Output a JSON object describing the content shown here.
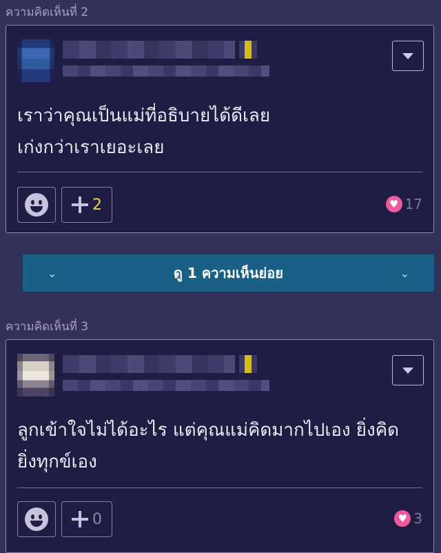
{
  "comments": [
    {
      "label": "ความคิดเห็นที่ 2",
      "avatar": "blue",
      "lines": [
        "เราว่าคุณเป็นแม่ที่อธิบายได้ดีเลย",
        "เก่งกว่าเราเยอะเลย"
      ],
      "plus_count": "2",
      "plus_count_color": "#f5d33c",
      "like_count": "17"
    },
    {
      "label": "ความคิดเห็นที่ 3",
      "avatar": "skin",
      "lines": [
        "ลูกเข้าใจไม่ได้อะไร แต่คุณแม่คิดมากไปเอง ยิ่งคิด",
        "ยิ่งทุกข์เอง"
      ],
      "plus_count": "0",
      "plus_count_color": "#8d88b4",
      "like_count": "3"
    }
  ],
  "expand_replies": {
    "label": "ดู 1 ความเห็นย่อย",
    "chevron": "⌄"
  },
  "icons": {
    "heart": "♥",
    "menu": "dropdown-triangle-icon",
    "emoji": "smiley-face-icon",
    "plus": "plus-icon"
  },
  "colors": {
    "background": "#34315a",
    "card": "#1f1d44",
    "expand_bar": "#1a5f85",
    "heart": "#ee5a9c",
    "badge": "#d7bc1f"
  }
}
